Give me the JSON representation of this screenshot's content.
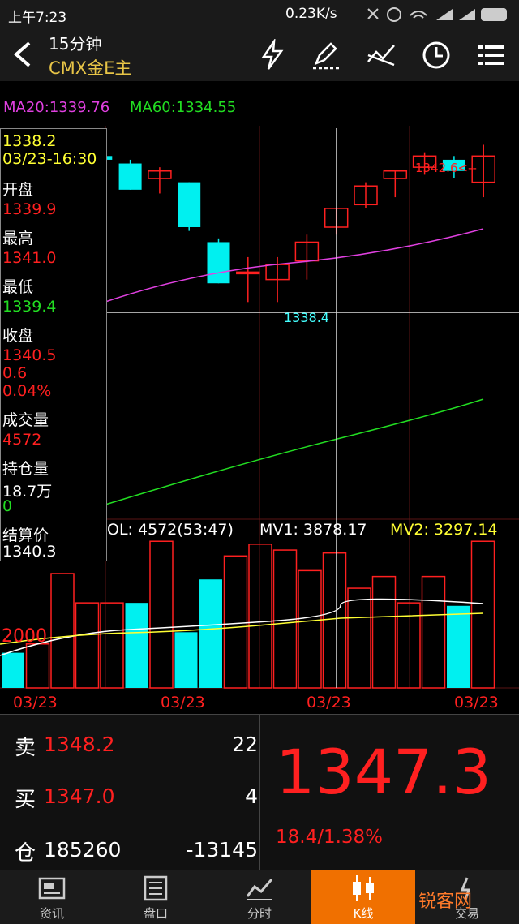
{
  "status_bar": {
    "time": "上午7:23",
    "network": "0.23K/s"
  },
  "header": {
    "period": "15分钟",
    "symbol": "CMX金E主"
  },
  "indicators": {
    "ma20": "MA20:1339.76",
    "ma60": "MA60:1334.55"
  },
  "chart_labels": {
    "high_marker": "1342.6<--",
    "crosshair_price": "1338.4"
  },
  "info_panel": {
    "cursor_price": "1338.2",
    "cursor_time": "03/23-16:30",
    "open_label": "开盘",
    "open": "1339.9",
    "high_label": "最高",
    "high": "1341.0",
    "low_label": "最低",
    "low": "1339.4",
    "close_label": "收盘",
    "close": "1340.5",
    "change": "0.6",
    "change_pct": "0.04%",
    "volume_label": "成交量",
    "volume": "4572",
    "oi_label": "持仓量",
    "oi": "18.7万",
    "oi_change": "0",
    "settle_label": "结算价",
    "settle": "1340.3"
  },
  "volume_header": {
    "vol": "OL: 4572(53:47)",
    "mv1": "MV1: 3878.17",
    "mv2": "MV2: 3297.14"
  },
  "volume_axis": "2000",
  "dates": [
    "03/23",
    "03/23",
    "03/23",
    "03/23"
  ],
  "quotes": {
    "sell_label": "卖",
    "sell_price": "1348.2",
    "sell_qty": "22",
    "buy_label": "买",
    "buy_price": "1347.0",
    "buy_qty": "4",
    "oi_label": "仓",
    "oi_value": "185260",
    "oi_change": "-13145",
    "last_price": "1347.3",
    "change": "18.4/1.38%"
  },
  "nav": [
    "资讯",
    "盘口",
    "分时",
    "K线",
    "交易"
  ],
  "watermark": "锐客网",
  "colors": {
    "up": "#ff2020",
    "down": "#00f0f0",
    "ma20": "#e040e0",
    "ma60": "#22dd22",
    "accent": "#f07000"
  },
  "chart_data": {
    "type": "candlestick",
    "candles": [
      {
        "open": 1340.5,
        "high": 1341.0,
        "low": 1339.2,
        "close": 1341.0
      },
      {
        "open": 1341.3,
        "high": 1341.4,
        "low": 1341.0,
        "close": 1341.2
      },
      {
        "open": 1341.1,
        "high": 1341.2,
        "low": 1340.4,
        "close": 1340.4
      },
      {
        "open": 1340.7,
        "high": 1341.0,
        "low": 1340.3,
        "close": 1340.9
      },
      {
        "open": 1340.6,
        "high": 1340.6,
        "low": 1339.3,
        "close": 1339.4
      },
      {
        "open": 1339.0,
        "high": 1339.1,
        "low": 1337.9,
        "close": 1337.9
      },
      {
        "open": 1338.2,
        "high": 1338.6,
        "low": 1337.4,
        "close": 1338.2
      },
      {
        "open": 1338.0,
        "high": 1338.6,
        "low": 1337.4,
        "close": 1338.4
      },
      {
        "open": 1338.5,
        "high": 1339.2,
        "low": 1338.0,
        "close": 1339.0
      },
      {
        "open": 1339.4,
        "high": 1339.9,
        "low": 1339.2,
        "close": 1339.9
      },
      {
        "open": 1340.0,
        "high": 1340.6,
        "low": 1339.9,
        "close": 1340.5
      },
      {
        "open": 1340.7,
        "high": 1340.9,
        "low": 1340.2,
        "close": 1340.9
      },
      {
        "open": 1341.0,
        "high": 1341.4,
        "low": 1340.8,
        "close": 1341.3
      },
      {
        "open": 1341.2,
        "high": 1341.3,
        "low": 1340.7,
        "close": 1340.9
      },
      {
        "open": 1340.6,
        "high": 1341.6,
        "low": 1340.2,
        "close": 1341.3
      }
    ],
    "volumes": [
      1200,
      1500,
      3900,
      2900,
      2900,
      2900,
      5000,
      1900,
      3700,
      4500,
      4900,
      4700,
      4000,
      4600,
      3400,
      3800,
      2900,
      3800,
      2800,
      5000
    ],
    "vol_up": [
      false,
      true,
      true,
      true,
      true,
      false,
      true,
      false,
      false,
      true,
      true,
      true,
      true,
      true,
      true,
      true,
      true,
      true,
      false,
      true
    ]
  }
}
